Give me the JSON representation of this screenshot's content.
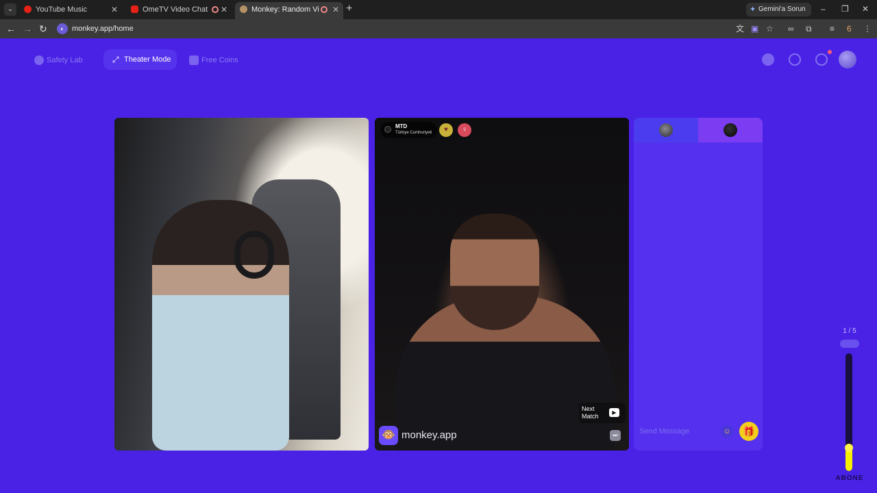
{
  "browser": {
    "tabs": [
      {
        "title": "YouTube Music",
        "favicon_color": "#e62117",
        "active": false
      },
      {
        "title": "OmeTV Video Chat — Ome",
        "favicon_color": "#e62117",
        "active": false
      },
      {
        "title": "Monkey: Random Video Ch",
        "favicon_color": "#b49266",
        "active": true
      }
    ],
    "new_tab_icon": "+",
    "gemini_label": "Gemini'a Sorun",
    "url": "monkey.app/home",
    "extension_count": "6",
    "window_controls": {
      "minimize": "–",
      "restore": "❐",
      "close": "✕"
    }
  },
  "nav": {
    "safety_lab": "Safety Lab",
    "theater_mode": "Theater Mode",
    "free_coins": "Free Coins"
  },
  "remote_user": {
    "name": "MTD",
    "country": "Türkiye Cumhuriyeti"
  },
  "video": {
    "brand_text": "monkey.app",
    "next_match": "Next Match"
  },
  "chat": {
    "placeholder": "Send Message"
  },
  "progress": {
    "count": "1 / 5",
    "fill_fraction": 0.2,
    "label": "ABONE"
  },
  "colors": {
    "page_bg": "#4a22e6",
    "chat_bg": "#5530ee",
    "accent_yellow": "#f6f000"
  }
}
